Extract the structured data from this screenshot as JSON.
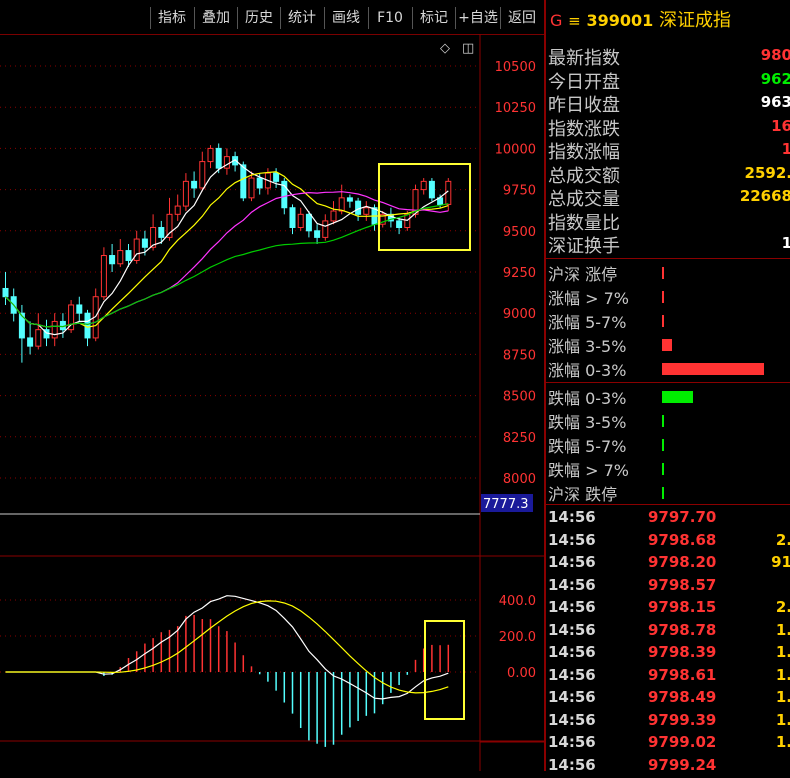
{
  "toolbar": {
    "buttons": [
      "指标",
      "叠加",
      "历史",
      "统计",
      "画线",
      "F10",
      "标记",
      "+自选",
      "返回"
    ]
  },
  "chart": {
    "price_ticks": [
      "10500",
      "10250",
      "10000",
      "9750",
      "9500",
      "9250",
      "9000",
      "8750",
      "8500",
      "8250",
      "8000"
    ],
    "cursor_value": "7777.3",
    "macd_ticks": [
      "400.0",
      "200.0",
      "0.00"
    ],
    "colors": {
      "up": "#ff3333",
      "down": "#54ffff",
      "ma5": "#ffffff",
      "ma10": "#ffff00",
      "ma20": "#ff33ff",
      "ma60": "#00cc00",
      "highlight": "#ffff33"
    }
  },
  "chart_data": {
    "type": "candlestick",
    "y_range": [
      7800,
      10650
    ],
    "candles": [
      [
        9150,
        9100,
        9250,
        9050
      ],
      [
        9100,
        9000,
        9150,
        8950
      ],
      [
        9000,
        8850,
        9050,
        8700
      ],
      [
        8850,
        8800,
        8950,
        8750
      ],
      [
        8800,
        8900,
        9000,
        8780
      ],
      [
        8900,
        8850,
        8960,
        8800
      ],
      [
        8850,
        8950,
        9000,
        8800
      ],
      [
        8950,
        8900,
        9000,
        8850
      ],
      [
        8900,
        9050,
        9080,
        8880
      ],
      [
        9050,
        9000,
        9100,
        8950
      ],
      [
        9000,
        8850,
        9020,
        8800
      ],
      [
        8850,
        9100,
        9150,
        8830
      ],
      [
        9100,
        9350,
        9400,
        9080
      ],
      [
        9350,
        9300,
        9420,
        9250
      ],
      [
        9300,
        9380,
        9450,
        9280
      ],
      [
        9380,
        9320,
        9420,
        9280
      ],
      [
        9320,
        9450,
        9500,
        9300
      ],
      [
        9450,
        9400,
        9500,
        9350
      ],
      [
        9400,
        9520,
        9600,
        9380
      ],
      [
        9520,
        9460,
        9560,
        9420
      ],
      [
        9460,
        9600,
        9700,
        9440
      ],
      [
        9600,
        9650,
        9720,
        9560
      ],
      [
        9650,
        9800,
        9850,
        9620
      ],
      [
        9800,
        9760,
        9860,
        9700
      ],
      [
        9760,
        9920,
        9980,
        9740
      ],
      [
        9920,
        10000,
        10020,
        9880
      ],
      [
        10000,
        9880,
        10030,
        9850
      ],
      [
        9880,
        9950,
        10000,
        9840
      ],
      [
        9950,
        9900,
        9980,
        9860
      ],
      [
        9900,
        9700,
        9920,
        9680
      ],
      [
        9700,
        9820,
        9860,
        9680
      ],
      [
        9820,
        9760,
        9850,
        9720
      ],
      [
        9760,
        9850,
        9880,
        9720
      ],
      [
        9850,
        9800,
        9880,
        9760
      ],
      [
        9800,
        9640,
        9820,
        9600
      ],
      [
        9640,
        9520,
        9660,
        9480
      ],
      [
        9520,
        9600,
        9640,
        9500
      ],
      [
        9600,
        9500,
        9620,
        9460
      ],
      [
        9500,
        9460,
        9540,
        9420
      ],
      [
        9460,
        9560,
        9600,
        9440
      ],
      [
        9560,
        9620,
        9680,
        9540
      ],
      [
        9620,
        9700,
        9780,
        9600
      ],
      [
        9700,
        9680,
        9720,
        9640
      ],
      [
        9680,
        9600,
        9700,
        9560
      ],
      [
        9600,
        9640,
        9680,
        9560
      ],
      [
        9640,
        9540,
        9660,
        9500
      ],
      [
        9540,
        9600,
        9620,
        9520
      ],
      [
        9600,
        9560,
        9640,
        9520
      ],
      [
        9560,
        9520,
        9580,
        9480
      ],
      [
        9520,
        9600,
        9620,
        9500
      ],
      [
        9600,
        9750,
        9780,
        9580
      ],
      [
        9750,
        9800,
        9820,
        9720
      ],
      [
        9800,
        9700,
        9820,
        9680
      ],
      [
        9700,
        9660,
        9720,
        9640
      ],
      [
        9660,
        9800,
        9820,
        9620
      ]
    ],
    "macd_range": [
      -300,
      500
    ]
  },
  "panel": {
    "code": "399001",
    "name": "深证成指",
    "quote_rows": [
      {
        "label": "最新指数",
        "value": "980",
        "color": "#ff3333"
      },
      {
        "label": "今日开盘",
        "value": "962",
        "color": "#00ee00"
      },
      {
        "label": "昨日收盘",
        "value": "963",
        "color": "#ffffff"
      },
      {
        "label": "指数涨跌",
        "value": "16",
        "color": "#ff3333"
      },
      {
        "label": "指数涨幅",
        "value": "1",
        "color": "#ff3333"
      },
      {
        "label": "总成交额",
        "value": "2592.",
        "color": "#ffd000"
      },
      {
        "label": "总成交量",
        "value": "22668",
        "color": "#ffd000"
      },
      {
        "label": "指数量比",
        "value": "",
        "color": "#ffd000"
      },
      {
        "label": "深证换手",
        "value": "1",
        "color": "#ffffff"
      }
    ],
    "dist_rows": [
      {
        "label": "沪深 涨停",
        "bar": 0.02,
        "color": "#ff3333"
      },
      {
        "label": "涨幅 > 7%",
        "bar": 0.02,
        "color": "#ff3333"
      },
      {
        "label": "涨幅 5-7%",
        "bar": 0.02,
        "color": "#ff3333"
      },
      {
        "label": "涨幅 3-5%",
        "bar": 0.1,
        "color": "#ff3333"
      },
      {
        "label": "涨幅 0-3%",
        "bar": 1.0,
        "color": "#ff3333"
      },
      {
        "label": "跌幅 0-3%",
        "bar": 0.3,
        "color": "#00ee00"
      },
      {
        "label": "跌幅 3-5%",
        "bar": 0.02,
        "color": "#00ee00"
      },
      {
        "label": "跌幅 5-7%",
        "bar": 0.02,
        "color": "#00ee00"
      },
      {
        "label": "跌幅 > 7%",
        "bar": 0.02,
        "color": "#00ee00"
      },
      {
        "label": "沪深 跌停",
        "bar": 0.02,
        "color": "#00ee00"
      }
    ],
    "ticks": [
      {
        "time": "14:56",
        "price": "9797.70",
        "vol": ""
      },
      {
        "time": "14:56",
        "price": "9798.68",
        "vol": "2."
      },
      {
        "time": "14:56",
        "price": "9798.20",
        "vol": "91"
      },
      {
        "time": "14:56",
        "price": "9798.57",
        "vol": ""
      },
      {
        "time": "14:56",
        "price": "9798.15",
        "vol": "2."
      },
      {
        "time": "14:56",
        "price": "9798.78",
        "vol": "1."
      },
      {
        "time": "14:56",
        "price": "9798.39",
        "vol": "1."
      },
      {
        "time": "14:56",
        "price": "9798.61",
        "vol": "1."
      },
      {
        "time": "14:56",
        "price": "9798.49",
        "vol": "1."
      },
      {
        "time": "14:56",
        "price": "9799.39",
        "vol": "1."
      },
      {
        "time": "14:56",
        "price": "9799.02",
        "vol": "1."
      },
      {
        "time": "14:56",
        "price": "9799.24",
        "vol": ""
      }
    ]
  }
}
